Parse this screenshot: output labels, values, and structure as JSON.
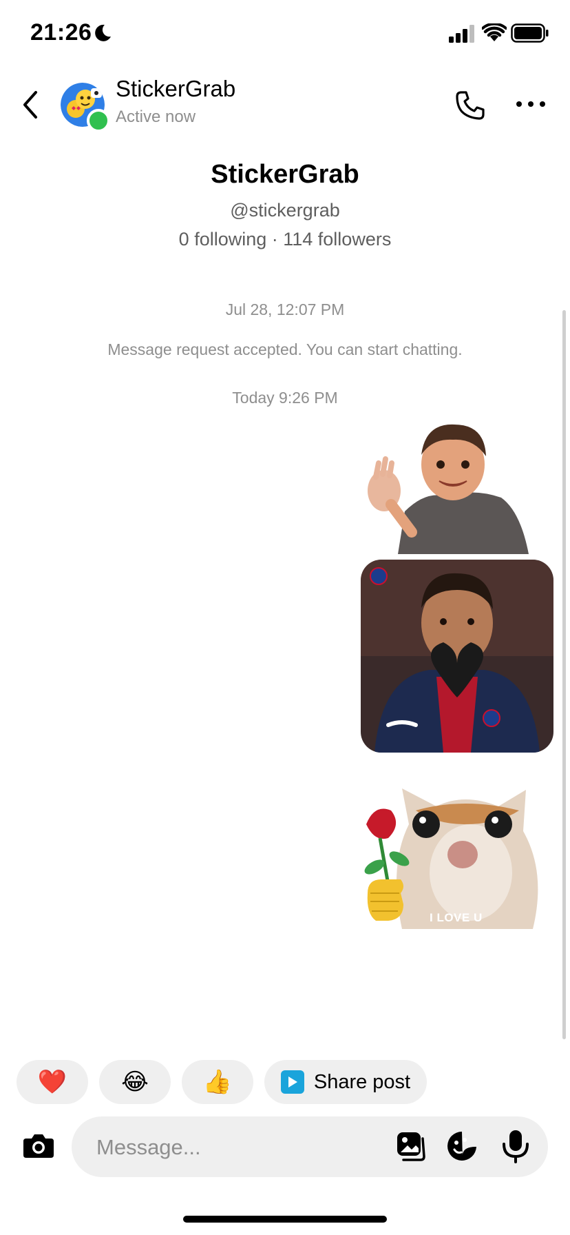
{
  "status_bar": {
    "time": "21:26",
    "icons": [
      "moon-icon",
      "signal-icon",
      "wifi-icon",
      "battery-icon"
    ]
  },
  "header": {
    "name": "StickerGrab",
    "status": "Active now",
    "back_icon": "chevron-left-icon",
    "call_icon": "phone-icon",
    "more_icon": "more-horizontal-icon"
  },
  "profile": {
    "name": "StickerGrab",
    "handle": "@stickergrab",
    "stats": "0 following · 114 followers"
  },
  "thread": {
    "timestamp_1": "Jul 28, 12:07 PM",
    "system_message": "Message request accepted. You can start chatting.",
    "timestamp_2": "Today 9:26 PM",
    "stickers": [
      {
        "name": "waving-kid-sticker"
      },
      {
        "name": "heart-hands-player-sticker"
      },
      {
        "name": "cat-with-rose-sticker",
        "caption": "I LOVE U"
      }
    ]
  },
  "quick_replies": {
    "heart": "❤️",
    "laugh": "😂",
    "thumbs_up": "👍",
    "share_label": "Share post"
  },
  "composer": {
    "placeholder": "Message..."
  },
  "colors": {
    "online": "#30c04f",
    "chip_bg": "#efefef",
    "share_icon": "#1aa4db",
    "secondary_text": "#8e8e8e"
  }
}
